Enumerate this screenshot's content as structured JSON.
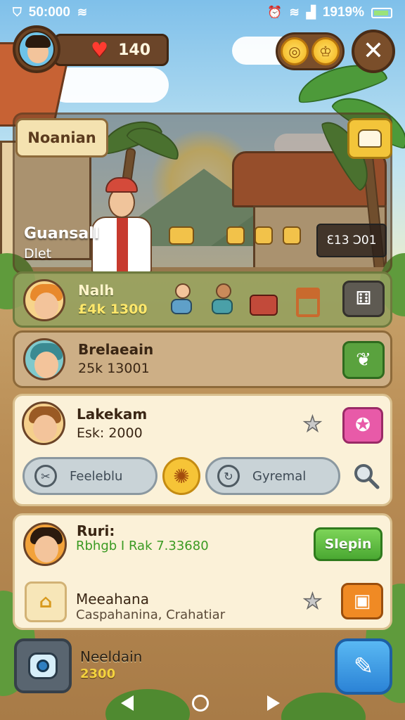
{
  "status_bar": {
    "left_text": "50:000",
    "right_text": "1919%",
    "icons": [
      "shield-icon",
      "wifi-icon",
      "alarm-icon",
      "wifi-icon",
      "signal-icon",
      "battery-icon"
    ]
  },
  "hud": {
    "lives": "140",
    "icons": [
      "avatar-icon",
      "heart-icon",
      "coin-icon",
      "close-icon"
    ]
  },
  "header": {
    "title": "Noanian",
    "character_name": "Guansall",
    "character_subtitle": "Dlet",
    "scene_badge": "Ɛ13 Ɔ01"
  },
  "rows": [
    {
      "name": "Nalh",
      "stat": "£4k 1300"
    },
    {
      "name": "Brelaeain",
      "stat": "25k 13001"
    }
  ],
  "card_3": {
    "name": "Lakekam",
    "stat": "Esk: 2000",
    "pill_left_label": "Feeleblu",
    "pill_right_label": "Gyremal"
  },
  "card_4": {
    "name": "Ruri:",
    "green_line": "Rbhgb I Rak 7.33680",
    "action_label": "Slepin",
    "item_title": "Meeahana",
    "item_subtitle": "Caspahanina, Crahatiar"
  },
  "bottom": {
    "name": "Neeldain",
    "value": "2300"
  },
  "colors": {
    "accent_green": "#4aa832",
    "accent_pink": "#e85aa8",
    "accent_orange": "#f08a24",
    "accent_blue": "#2b83d6",
    "gold": "#f6c437"
  }
}
